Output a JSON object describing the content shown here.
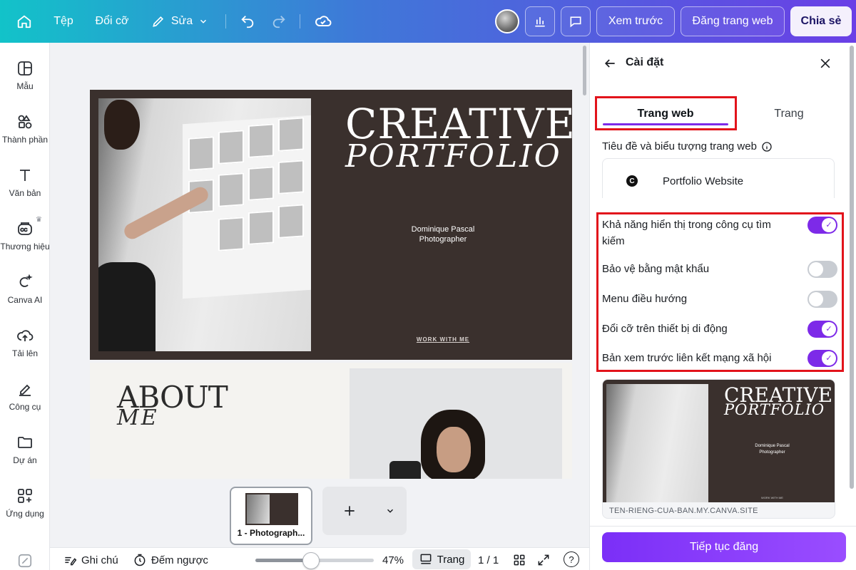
{
  "topbar": {
    "file_label": "Tệp",
    "resize_label": "Đổi cỡ",
    "edit_label": "Sửa",
    "preview_label": "Xem trước",
    "publish_label": "Đăng trang web",
    "share_label": "Chia sẻ"
  },
  "sidebar": {
    "items": [
      {
        "label": "Mẫu",
        "icon": "template-icon"
      },
      {
        "label": "Thành phần",
        "icon": "elements-icon"
      },
      {
        "label": "Văn bản",
        "icon": "text-icon"
      },
      {
        "label": "Thương hiệu",
        "icon": "brand-icon"
      },
      {
        "label": "Canva AI",
        "icon": "canva-ai-icon"
      },
      {
        "label": "Tải lên",
        "icon": "upload-icon"
      },
      {
        "label": "Công cụ",
        "icon": "tools-icon"
      },
      {
        "label": "Dự án",
        "icon": "folder-icon"
      },
      {
        "label": "Ứng dụng",
        "icon": "apps-icon"
      }
    ]
  },
  "canvas": {
    "page1": {
      "title": "CREATIVE",
      "subtitle": "PORTFOLIO",
      "name_line1": "Dominique Pascal",
      "name_line2": "Photographer",
      "cta": "WORK WITH ME"
    },
    "page2": {
      "heading": "ABOUT",
      "heading_sub": "ME"
    }
  },
  "pages_strip": {
    "thumb_label": "1 - Photograph..."
  },
  "bottombar": {
    "notes_label": "Ghi chú",
    "timer_label": "Đếm ngược",
    "zoom_label": "47%",
    "zoom_value": 0.47,
    "pages_label": "Trang",
    "page_count": "1 / 1",
    "help_label": "?"
  },
  "panel": {
    "title": "Cài đặt",
    "tabs": [
      {
        "label": "Trang web",
        "active": true
      },
      {
        "label": "Trang",
        "active": false
      }
    ],
    "site_title_label": "Tiêu đề và biểu tượng trang web",
    "favicon_letter": "C",
    "site_title_value": "Portfolio Website",
    "toggles": [
      {
        "label": "Khả năng hiển thị trong công cụ tìm kiếm",
        "on": true
      },
      {
        "label": "Bảo vệ bằng mật khẩu",
        "on": false
      },
      {
        "label": "Menu điều hướng",
        "on": false
      },
      {
        "label": "Đổi cỡ trên thiết bị di động",
        "on": true
      },
      {
        "label": "Bản xem trước liên kết mạng xã hội",
        "on": true
      }
    ],
    "preview": {
      "title": "CREATIVE",
      "subtitle": "PORTFOLIO",
      "name_line1": "Dominique Pascal",
      "name_line2": "Photographer",
      "cta": "WORK WITH ME",
      "url": "TEN-RIENG-CUA-BAN.MY.CANVA.SITE"
    },
    "publish_button": "Tiếp tục đăng"
  },
  "colors": {
    "accent": "#7d2ae8",
    "highlight": "#e2131b",
    "canvas_dark": "#3a302d"
  }
}
